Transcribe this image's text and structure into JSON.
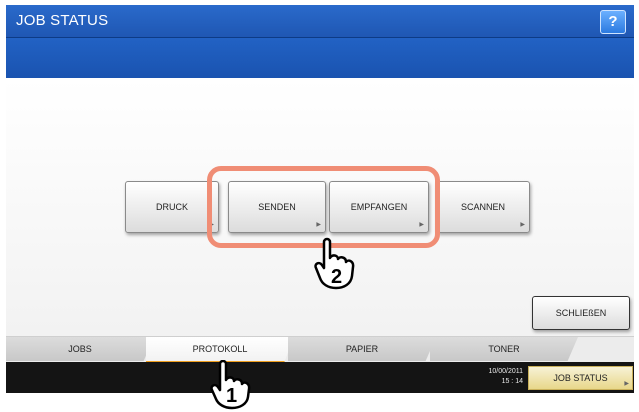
{
  "window": {
    "title": "JOB STATUS",
    "help_label": "?"
  },
  "buttons": {
    "druck": "DRUCK",
    "senden": "SENDEN",
    "empfangen": "EMPFANGEN",
    "scannen": "SCANNEN",
    "schliessen": "SCHLIEßEN"
  },
  "tabs": [
    {
      "label": "JOBS"
    },
    {
      "label": "PROTOKOLL"
    },
    {
      "label": "PAPIER"
    },
    {
      "label": "TONER"
    }
  ],
  "status": {
    "date": "10/00/2011",
    "time": "15 : 14",
    "job_status_label": "JOB STATUS"
  },
  "annotations": {
    "step1": "1",
    "step2": "2"
  },
  "colors": {
    "title_bar": "#2a6acb",
    "highlight": "#f08d75",
    "active_tab_underline": "#f0a020"
  }
}
